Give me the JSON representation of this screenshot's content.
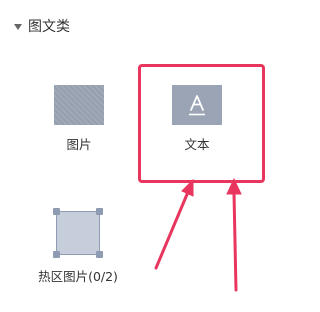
{
  "section": {
    "title": "图文类",
    "expanded": true
  },
  "widgets": [
    {
      "label": "图片",
      "icon": "image-placeholder-icon"
    },
    {
      "label": "文本",
      "icon": "text-letter-a-icon",
      "highlighted": true
    },
    {
      "label": "热区图片(0/2)",
      "icon": "hotspot-image-icon"
    }
  ],
  "colors": {
    "highlight": "#e8365e",
    "thumb": "#9aa4b4",
    "text": "#333333"
  }
}
